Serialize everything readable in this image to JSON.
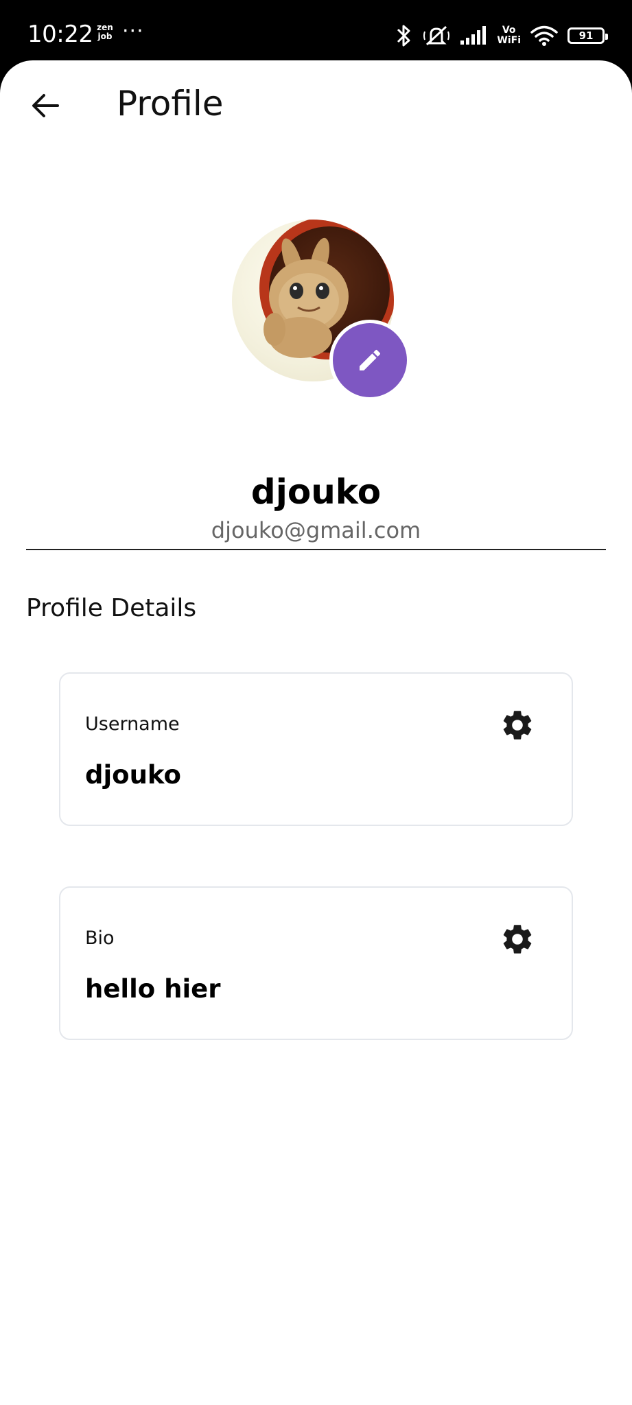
{
  "status_bar": {
    "time": "10:22",
    "app_badge_line1": "zen",
    "app_badge_line2": "job",
    "more": "···",
    "vo_line1": "Vo",
    "vo_line2": "WiFi",
    "battery": "91",
    "icons": [
      "bluetooth-icon",
      "mute-icon",
      "signal-icon",
      "vowifi-icon",
      "wifi-icon",
      "battery-icon"
    ]
  },
  "header": {
    "title": "Profile",
    "back_icon": "arrow-left-icon"
  },
  "profile": {
    "name": "djouko",
    "email": "djouko@gmail.com",
    "edit_icon": "pencil-icon",
    "accent_color": "#7e57c2"
  },
  "details": {
    "section_title": "Profile Details",
    "cards": [
      {
        "label": "Username",
        "value": "djouko",
        "icon": "gear-icon"
      },
      {
        "label": "Bio",
        "value": "hello hier",
        "icon": "gear-icon"
      }
    ]
  }
}
